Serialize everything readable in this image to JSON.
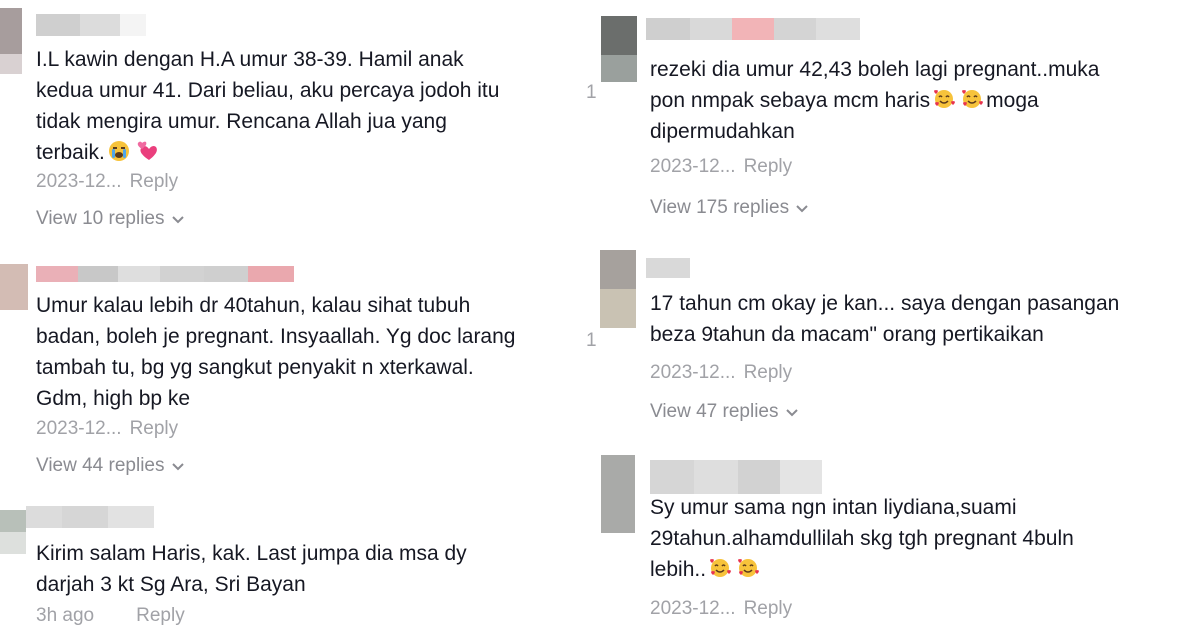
{
  "left": [
    {
      "text": "I.L kawin dengan H.A umur 38-39. Hamil anak\nkedua umur 41. Dari beliau, aku percaya jodoh itu\ntidak mengira umur. Rencana Allah jua yang\nterbaik.",
      "emojis": [
        "crying-face-emoji",
        "two-hearts-emoji"
      ],
      "date": "2023-12...",
      "reply": "Reply",
      "view_replies": "View 10 replies"
    },
    {
      "text": "Umur kalau lebih dr 40tahun, kalau sihat tubuh\nbadan, boleh je pregnant. Insyaallah. Yg doc larang\ntambah tu, bg yg sangkut penyakit n xterkawal.\nGdm, high bp ke",
      "date": "2023-12...",
      "reply": "Reply",
      "view_replies": "View 44 replies"
    },
    {
      "text": "Kirim salam Haris, kak. Last jumpa dia msa dy\ndarjah 3 kt Sg Ara, Sri Bayan",
      "date": "3h ago",
      "reply": "Reply"
    }
  ],
  "right": [
    {
      "text": "rezeki dia umur 42,43 boleh lagi pregnant..muka\npon nmpak sebaya mcm haris",
      "text_tail": "moga\ndipermudahkan",
      "emojis": [
        "smiling-face-with-hearts-emoji",
        "smiling-face-with-hearts-emoji"
      ],
      "date": "2023-12...",
      "reply": "Reply",
      "view_replies": "View 175 replies"
    },
    {
      "text": "17 tahun cm okay je kan... saya dengan pasangan\nbeza 9tahun da macam\" orang pertikaikan",
      "date": "2023-12...",
      "reply": "Reply",
      "view_replies": "View 47 replies"
    },
    {
      "text": "Sy umur sama ngn intan liydiana,suami\n29tahun.alhamdullilah skg tgh pregnant 4buln\nlebih..",
      "emojis": [
        "smiling-face-with-hearts-emoji",
        "smiling-face-with-hearts-emoji"
      ],
      "date": "2023-12...",
      "reply": "Reply"
    }
  ],
  "cut_glyphs": [
    "1",
    "1"
  ],
  "colors": {
    "text": "#161823",
    "meta": "#a1a2a7",
    "view_replies": "#8a8b91"
  }
}
